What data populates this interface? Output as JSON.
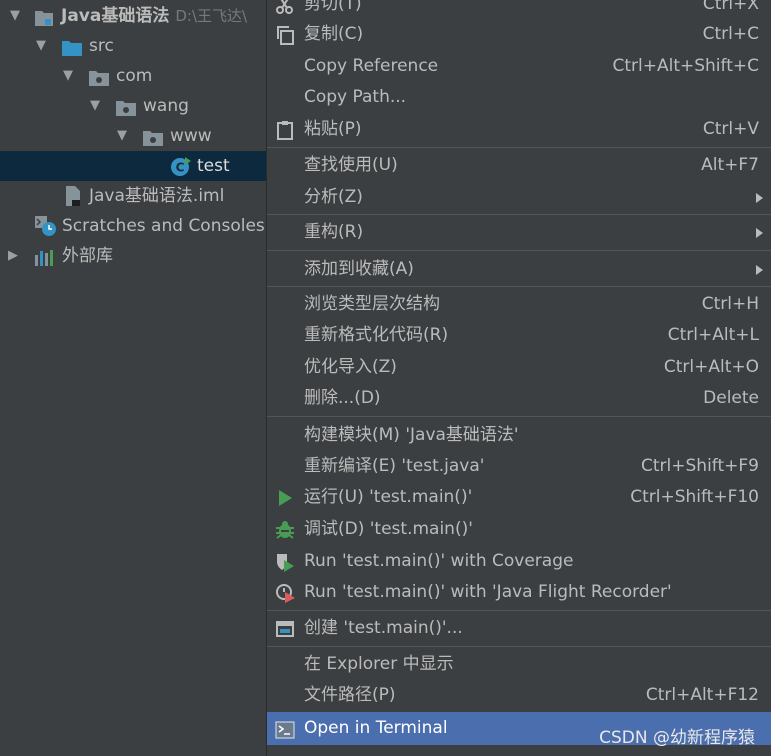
{
  "tree": {
    "project": {
      "name": "Java基础语法",
      "path": "D:\\王飞达\\"
    },
    "src": "src",
    "com": "com",
    "wang": "wang",
    "www": "www",
    "test": "test",
    "iml": "Java基础语法.iml",
    "scratches": "Scratches and Consoles",
    "external": "外部库"
  },
  "menu": {
    "cut": {
      "label": "剪切(T)",
      "shortcut": "Ctrl+X",
      "icon": "scissors-icon"
    },
    "copy": {
      "label": "复制(C)",
      "shortcut": "Ctrl+C",
      "icon": "copy-icon"
    },
    "copy_reference": {
      "label": "Copy Reference",
      "shortcut": "Ctrl+Alt+Shift+C"
    },
    "copy_path": {
      "label": "Copy Path..."
    },
    "paste": {
      "label": "粘贴(P)",
      "shortcut": "Ctrl+V",
      "icon": "clipboard-icon"
    },
    "find_usages": {
      "label": "查找使用(U)",
      "shortcut": "Alt+F7"
    },
    "analyze": {
      "label": "分析(Z)"
    },
    "refactor": {
      "label": "重构(R)"
    },
    "add_favorites": {
      "label": "添加到收藏(A)"
    },
    "type_hierarchy": {
      "label": "浏览类型层次结构",
      "shortcut": "Ctrl+H"
    },
    "reformat": {
      "label": "重新格式化代码(R)",
      "shortcut": "Ctrl+Alt+L"
    },
    "optimize_imports": {
      "label": "优化导入(Z)",
      "shortcut": "Ctrl+Alt+O"
    },
    "delete": {
      "label": "删除...(D)",
      "shortcut": "Delete"
    },
    "build_module": {
      "label": "构建模块(M) 'Java基础语法'"
    },
    "recompile": {
      "label": "重新编译(E) 'test.java'",
      "shortcut": "Ctrl+Shift+F9"
    },
    "run": {
      "label": "运行(U) 'test.main()'",
      "shortcut": "Ctrl+Shift+F10",
      "icon": "run-icon"
    },
    "debug": {
      "label": "调试(D) 'test.main()'",
      "icon": "bug-icon"
    },
    "run_coverage": {
      "label": "Run 'test.main()' with Coverage",
      "icon": "coverage-icon"
    },
    "run_jfr": {
      "label": "Run 'test.main()' with 'Java Flight Recorder'",
      "icon": "flight-recorder-icon"
    },
    "create_config": {
      "label": "创建 'test.main()'...",
      "icon": "window-icon"
    },
    "show_explorer": {
      "label": "在 Explorer 中显示"
    },
    "file_path": {
      "label": "文件路径(P)",
      "shortcut": "Ctrl+Alt+F12"
    },
    "open_terminal": {
      "label": "Open in Terminal",
      "icon": "terminal-icon"
    }
  },
  "watermark": "CSDN @幼新程序猿",
  "colors": {
    "background": "#3c3f41",
    "selection": "#4b6eaf",
    "tree_selection": "#0d293e",
    "run_green": "#499c54",
    "folder_blue": "#3592c4"
  }
}
